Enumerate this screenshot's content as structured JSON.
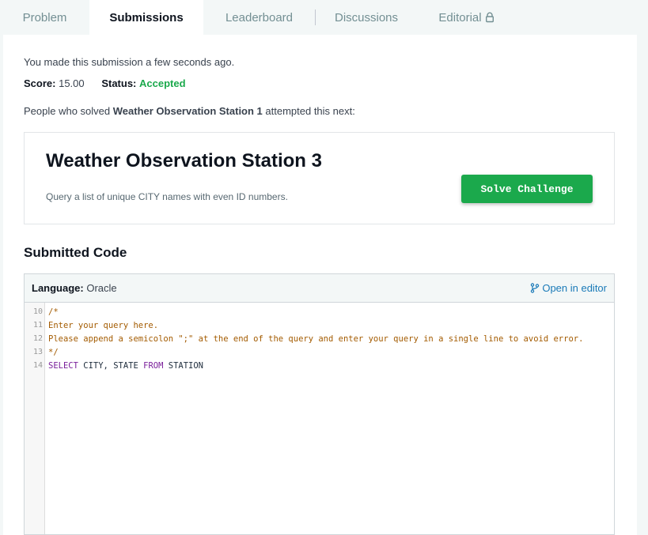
{
  "tabs": [
    {
      "label": "Problem"
    },
    {
      "label": "Submissions"
    },
    {
      "label": "Leaderboard"
    },
    {
      "label": "Discussions"
    },
    {
      "label": "Editorial"
    }
  ],
  "submission": {
    "made_text": "You made this submission a few seconds ago.",
    "score_label": "Score:",
    "score_value": "15.00",
    "status_label": "Status:",
    "status_value": "Accepted",
    "solved_prefix": "People who solved ",
    "solved_challenge": "Weather Observation Station 1",
    "solved_suffix": " attempted this next:"
  },
  "next_challenge": {
    "title": "Weather Observation Station 3",
    "description": "Query a list of unique CITY names with even ID numbers.",
    "button_label": "Solve Challenge"
  },
  "submitted_code": {
    "heading": "Submitted Code",
    "language_label": "Language:",
    "language_value": "Oracle",
    "open_editor_label": "Open in editor",
    "lines": [
      {
        "num": "10",
        "text": "/*"
      },
      {
        "num": "11",
        "text": "Enter your query here."
      },
      {
        "num": "12",
        "text": "Please append a semicolon \";\" at the end of the query and enter your query in a single line to avoid error."
      },
      {
        "num": "13",
        "text": "*/"
      },
      {
        "num": "14",
        "kw1": "SELECT",
        "mid": " CITY, STATE ",
        "kw2": "FROM",
        "tail": " STATION"
      }
    ]
  },
  "colors": {
    "accent_green": "#1ba94c",
    "link_blue": "#1a7ab8",
    "comment_orange": "#a35b00",
    "keyword_purple": "#7a1e9a"
  },
  "icons": {
    "editorial": "lock-icon",
    "open_editor": "branch-icon"
  }
}
